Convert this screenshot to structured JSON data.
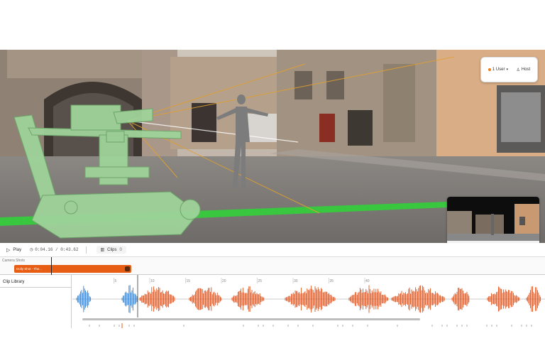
{
  "presence": {
    "users_label": "1 User",
    "host_label": "Host"
  },
  "transport": {
    "play_label": "Play",
    "timecode": "0:04.16 / 0:43.62",
    "clips_label": "Clips",
    "clips_count": "0"
  },
  "shots": {
    "track_label": "Camera Shots",
    "clip_label": "Dolly Shot - The..."
  },
  "library": {
    "title": "Clip Library"
  },
  "ruler": {
    "ticks": [
      "5",
      "10",
      "15",
      "20",
      "25",
      "30",
      "35",
      "40"
    ]
  },
  "colors": {
    "accent": "#e85d14",
    "waveform_past": "#2d86e0",
    "waveform_future": "#e0521a",
    "floor_line": "#39c740",
    "rig": "#9fd39a"
  },
  "icons": {
    "play": "play-icon",
    "clock": "clock-icon",
    "clips": "clips-icon",
    "close": "close-icon",
    "users": "users-icon",
    "host": "host-icon"
  }
}
